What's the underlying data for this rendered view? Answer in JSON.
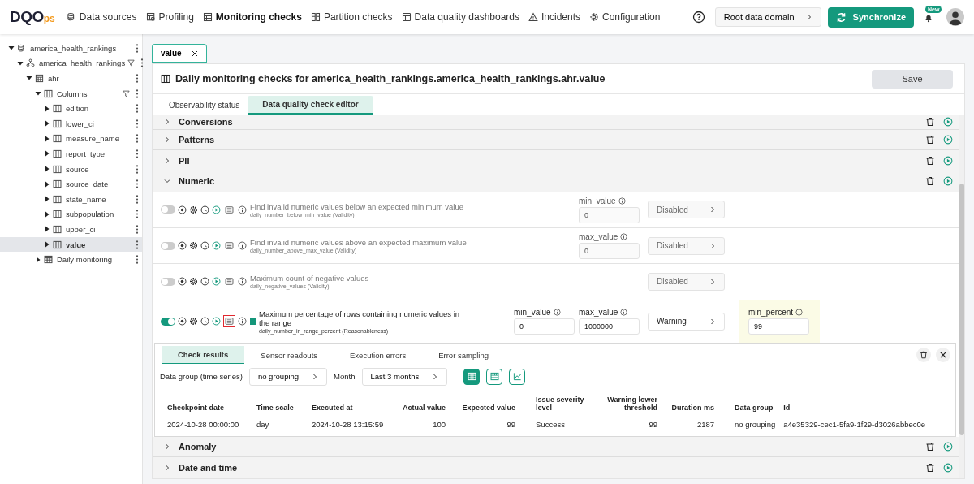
{
  "header": {
    "logo": {
      "main": "DQO",
      "suffix": "ps"
    },
    "nav": [
      {
        "kind": "sources",
        "label": "Data sources",
        "selected": false
      },
      {
        "kind": "profiling",
        "label": "Profiling",
        "selected": false
      },
      {
        "kind": "monitoring",
        "label": "Monitoring checks",
        "selected": true
      },
      {
        "kind": "partition",
        "label": "Partition checks",
        "selected": false
      },
      {
        "kind": "dashboards",
        "label": "Data quality dashboards",
        "selected": false
      },
      {
        "kind": "incidents",
        "label": "Incidents",
        "selected": false
      },
      {
        "kind": "configuration",
        "label": "Configuration",
        "selected": false
      }
    ],
    "domain_button": "Root data domain",
    "sync_button": "Synchronize",
    "notification_badge": "New"
  },
  "sidebar": {
    "tree": [
      {
        "kind": "database",
        "label": "america_health_rankings",
        "expanded": true,
        "filter": false,
        "selected": false,
        "children": [
          {
            "kind": "schema",
            "label": "america_health_rankings",
            "expanded": true,
            "filter": true,
            "selected": false,
            "children": [
              {
                "kind": "table",
                "label": "ahr",
                "expanded": true,
                "filter": false,
                "selected": false,
                "children": [
                  {
                    "kind": "columns",
                    "label": "Columns",
                    "expanded": true,
                    "filter": true,
                    "selected": false,
                    "children": [
                      {
                        "kind": "column",
                        "label": "edition",
                        "expanded": false,
                        "filter": false,
                        "selected": false
                      },
                      {
                        "kind": "column",
                        "label": "lower_ci",
                        "expanded": false,
                        "filter": false,
                        "selected": false
                      },
                      {
                        "kind": "column",
                        "label": "measure_name",
                        "expanded": false,
                        "filter": false,
                        "selected": false
                      },
                      {
                        "kind": "column",
                        "label": "report_type",
                        "expanded": false,
                        "filter": false,
                        "selected": false
                      },
                      {
                        "kind": "column",
                        "label": "source",
                        "expanded": false,
                        "filter": false,
                        "selected": false
                      },
                      {
                        "kind": "column",
                        "label": "source_date",
                        "expanded": false,
                        "filter": false,
                        "selected": false
                      },
                      {
                        "kind": "column",
                        "label": "state_name",
                        "expanded": false,
                        "filter": false,
                        "selected": false
                      },
                      {
                        "kind": "column",
                        "label": "subpopulation",
                        "expanded": false,
                        "filter": false,
                        "selected": false
                      },
                      {
                        "kind": "column",
                        "label": "upper_ci",
                        "expanded": false,
                        "filter": false,
                        "selected": false
                      },
                      {
                        "kind": "column",
                        "label": "value",
                        "expanded": false,
                        "filter": false,
                        "selected": true
                      }
                    ]
                  },
                  {
                    "kind": "monitoring",
                    "label": "Daily monitoring",
                    "expanded": false,
                    "filter": false,
                    "selected": false
                  }
                ]
              }
            ]
          }
        ]
      }
    ]
  },
  "editor_tabs": [
    {
      "label": "value",
      "selected": true
    }
  ],
  "panel": {
    "title": "Daily monitoring checks for america_health_rankings.america_health_rankings.ahr.value",
    "save_button": "Save",
    "tabs": [
      {
        "label": "Observability status",
        "selected": false
      },
      {
        "label": "Data quality check editor",
        "selected": true
      }
    ],
    "sections": [
      {
        "name": "Conversions",
        "expanded": false
      },
      {
        "name": "Patterns",
        "expanded": false
      },
      {
        "name": "PII",
        "expanded": false
      },
      {
        "name": "Numeric",
        "expanded": true,
        "checks": [
          {
            "enabled": false,
            "title": "Find invalid numeric values below an expected minimum value",
            "check_name": "daily_number_below_min_value (Validity)",
            "params": [
              {
                "label": "min_value",
                "value": "0"
              }
            ],
            "severity": "Disabled",
            "results_open": false
          },
          {
            "enabled": false,
            "title": "Find invalid numeric values above an expected maximum value",
            "check_name": "daily_number_above_max_value (Validity)",
            "params": [
              {
                "label": "max_value",
                "value": "0"
              }
            ],
            "severity": "Disabled",
            "results_open": false
          },
          {
            "enabled": false,
            "title": "Maximum count of negative values",
            "check_name": "daily_negative_values (Validity)",
            "severity": "Disabled",
            "results_open": false
          },
          {
            "enabled": true,
            "title": "Maximum percentage of rows containing numeric values in the range",
            "check_name": "daily_number_in_range_percent (Reasonableness)",
            "color": "#14967a",
            "params": [
              {
                "label": "min_value",
                "value": "0"
              },
              {
                "label": "max_value",
                "value": "1000000"
              }
            ],
            "severity": "Warning",
            "rule": {
              "label": "min_percent",
              "value": "99"
            },
            "results_open": true,
            "results": {
              "tabs": [
                {
                  "label": "Check results",
                  "selected": true
                },
                {
                  "label": "Sensor readouts",
                  "selected": false
                },
                {
                  "label": "Execution errors",
                  "selected": false
                },
                {
                  "label": "Error sampling",
                  "selected": false
                }
              ],
              "data_group_label": "Data group (time series)",
              "data_group": "no grouping",
              "month_label": "Month",
              "month": "Last 3 months",
              "views": [
                {
                  "kind": "table",
                  "selected": true
                },
                {
                  "kind": "grid",
                  "selected": false
                },
                {
                  "kind": "chart",
                  "selected": false
                }
              ],
              "columns": [
                {
                  "label": "Checkpoint date",
                  "kind": "text"
                },
                {
                  "label": "Time scale",
                  "kind": "text"
                },
                {
                  "label": "Executed at",
                  "kind": "text"
                },
                {
                  "label": "Actual value",
                  "kind": "number"
                },
                {
                  "label": "Expected value",
                  "kind": "number"
                },
                {
                  "label": "Issue severity level",
                  "kind": "text"
                },
                {
                  "label": "Warning lower threshold",
                  "kind": "number"
                },
                {
                  "label": "Duration ms",
                  "kind": "number"
                },
                {
                  "label": "Data group",
                  "kind": "text"
                },
                {
                  "label": "Id",
                  "kind": "text"
                }
              ],
              "rows": [
                [
                  "2024-10-28 00:00:00",
                  "day",
                  "2024-10-28 13:15:59",
                  "100",
                  "99",
                  "Success",
                  "99",
                  "2187",
                  "no grouping",
                  "a4e35329-cec1-5fa9-1f29-d3026abbec0e"
                ]
              ]
            }
          }
        ]
      },
      {
        "name": "Anomaly",
        "expanded": false
      },
      {
        "name": "Date and time",
        "expanded": false
      }
    ]
  }
}
